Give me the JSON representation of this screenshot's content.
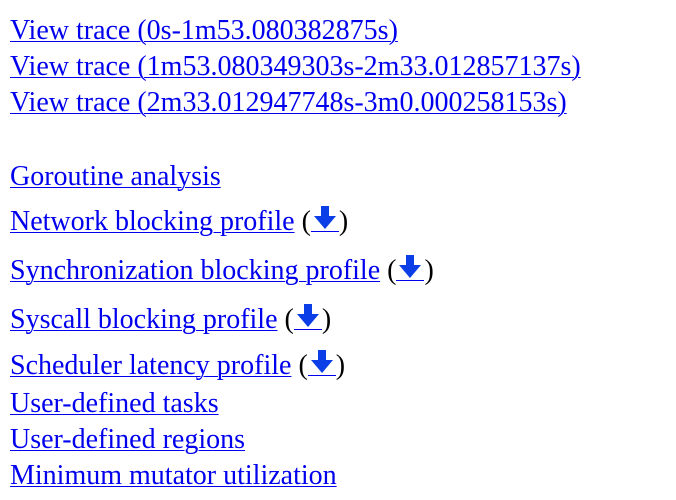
{
  "traces": [
    {
      "label": "View trace (0s-1m53.080382875s)"
    },
    {
      "label": "View trace (1m53.080349303s-2m33.012857137s)"
    },
    {
      "label": "View trace (2m33.012947748s-3m0.000258153s)"
    }
  ],
  "analysis": {
    "goroutine": "Goroutine analysis",
    "network": "Network blocking profile",
    "sync": "Synchronization blocking profile",
    "syscall": "Syscall blocking profile",
    "sched": "Scheduler latency profile",
    "tasks": "User-defined tasks",
    "regions": "User-defined regions",
    "mmu": "Minimum mutator utilization"
  },
  "paren_open": "(",
  "paren_close": ")",
  "colors": {
    "link": "#0000ee",
    "download_icon": "#0b3ee6"
  },
  "icons": {
    "download": "download-arrow-icon"
  }
}
